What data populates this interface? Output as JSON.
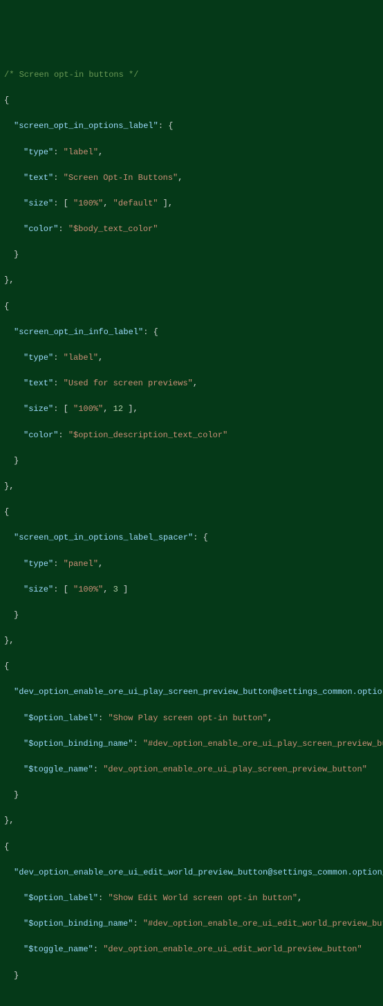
{
  "code": {
    "comment": "/* Screen opt-in buttons */",
    "block1": {
      "key": "\"screen_opt_in_options_label\"",
      "typeK": "\"type\"",
      "typeV": "\"label\"",
      "textK": "\"text\"",
      "textV": "\"Screen Opt-In Buttons\"",
      "sizeK": "\"size\"",
      "sizeV1": "\"100%\"",
      "sizeV2": "\"default\"",
      "colorK": "\"color\"",
      "colorV": "\"$body_text_color\""
    },
    "block2": {
      "key": "\"screen_opt_in_info_label\"",
      "typeK": "\"type\"",
      "typeV": "\"label\"",
      "textK": "\"text\"",
      "textV": "\"Used for screen previews\"",
      "sizeK": "\"size\"",
      "sizeV1": "\"100%\"",
      "sizeV2": "12",
      "colorK": "\"color\"",
      "colorV": "\"$option_description_text_color\""
    },
    "block3": {
      "key": "\"screen_opt_in_options_label_spacer\"",
      "typeK": "\"type\"",
      "typeV": "\"panel\"",
      "sizeK": "\"size\"",
      "sizeV1": "\"100%\"",
      "sizeV2": "3"
    },
    "block4": {
      "key": "\"dev_option_enable_ore_ui_play_screen_preview_button@settings_common.option_toggle\"",
      "labelK": "\"$option_label\"",
      "labelV": "\"Show Play screen opt-in button\"",
      "bindK": "\"$option_binding_name\"",
      "bindV": "\"#dev_option_enable_ore_ui_play_screen_preview_button\"",
      "toggleK": "\"$toggle_name\"",
      "toggleV": "\"dev_option_enable_ore_ui_play_screen_preview_button\""
    },
    "block5": {
      "key": "\"dev_option_enable_ore_ui_edit_world_preview_button@settings_common.option_toggle\"",
      "labelK": "\"$option_label\"",
      "labelV": "\"Show Edit World screen opt-in button\"",
      "bindK": "\"$option_binding_name\"",
      "bindV": "\"#dev_option_enable_ore_ui_edit_world_preview_button\"",
      "toggleK": "\"$toggle_name\"",
      "toggleV": "\"dev_option_enable_ore_ui_edit_world_preview_button\""
    },
    "punct": {
      "obr": "{",
      "cbr": "}",
      "cbrc": "},",
      "colOpen": ": {",
      "col": ": ",
      "arrOpen": ": [ ",
      "arrMid": ", ",
      "arrEnd": " ],",
      "arrEnd2": " ]",
      "comma": ","
    }
  }
}
